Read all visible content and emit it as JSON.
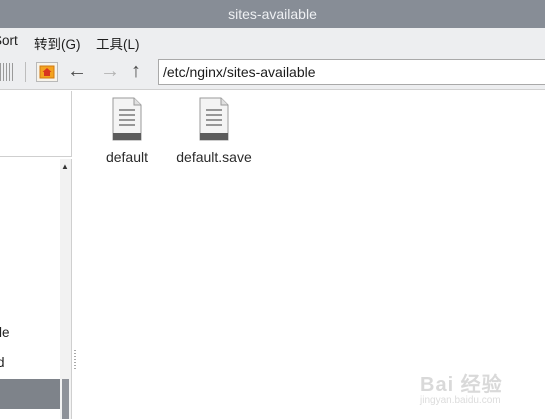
{
  "window": {
    "title": "sites-available"
  },
  "menu": {
    "items": [
      "Sort",
      "转到(G)",
      "工具(L)"
    ]
  },
  "toolbar": {
    "path": "/etc/nginx/sites-available"
  },
  "sidebar": {
    "items": [
      "le",
      "d"
    ]
  },
  "files": [
    {
      "name": "default",
      "icon": "text-file-icon"
    },
    {
      "name": "default.save",
      "icon": "text-file-icon"
    }
  ],
  "watermark": {
    "text": "Bai 经验",
    "sub": "jingyan.baidu.com"
  },
  "colors": {
    "titlebar": "#878d96",
    "selected": "#7e838a",
    "bar": "#edeef0"
  }
}
